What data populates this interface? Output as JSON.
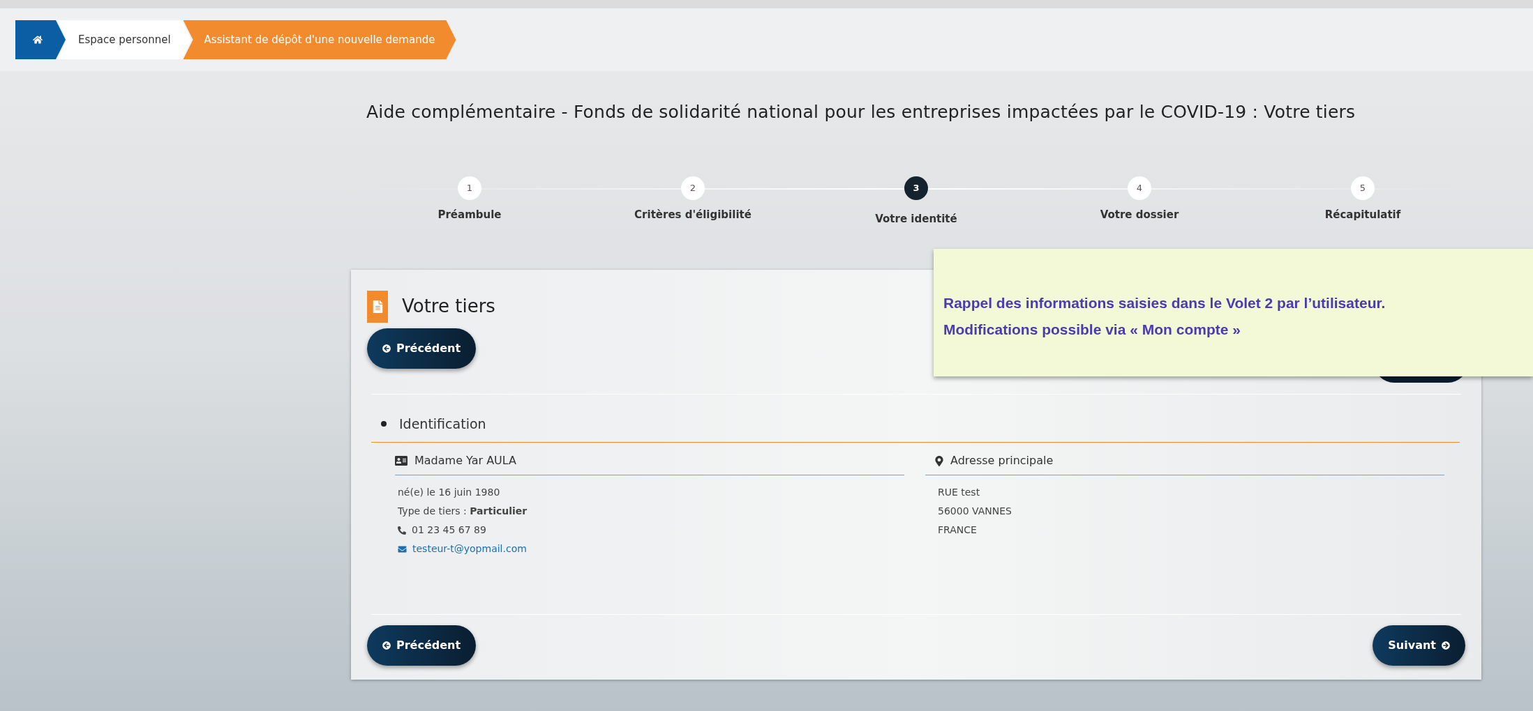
{
  "breadcrumb": [
    {
      "kind": "home",
      "selected": false
    },
    {
      "kind": "text",
      "label": "Espace personnel",
      "selected": false
    },
    {
      "kind": "text",
      "label": "Assistant de dépôt d'une nouvelle demande",
      "selected": true
    }
  ],
  "page_title": "Aide complémentaire - Fonds de solidarité national pour les entreprises impactées par le COVID-19 : Votre tiers",
  "steps": [
    {
      "number": "1",
      "label": "Préambule",
      "selected": false
    },
    {
      "number": "2",
      "label": "Critères d'éligibilité",
      "selected": false
    },
    {
      "number": "3",
      "label": "Votre identité",
      "selected": true
    },
    {
      "number": "4",
      "label": "Votre dossier",
      "selected": false
    },
    {
      "number": "5",
      "label": "Récapitulatif",
      "selected": false
    }
  ],
  "card": {
    "title": "Votre tiers",
    "top_previous": "Précédent",
    "section": "Identification",
    "person": {
      "heading": "Madame Yar AULA",
      "lines": [
        {
          "kind": "text",
          "text": "né(e) le 16 juin 1980"
        },
        {
          "kind": "text",
          "text": "Type de tiers : **Particulier**"
        },
        {
          "kind": "phone",
          "text": "01 23 45 67 89"
        },
        {
          "kind": "email",
          "text": "testeur-t@yopmail.com"
        }
      ]
    },
    "address": {
      "heading": "Adresse principale",
      "lines": [
        "RUE test",
        "56000 VANNES",
        "FRANCE"
      ]
    },
    "previous": "Précédent",
    "next": "Suivant"
  },
  "note": [
    "Rappel des informations saisies dans le Volet 2 par l’utilisateur.",
    "Modifications possible via « Mon compte »"
  ]
}
